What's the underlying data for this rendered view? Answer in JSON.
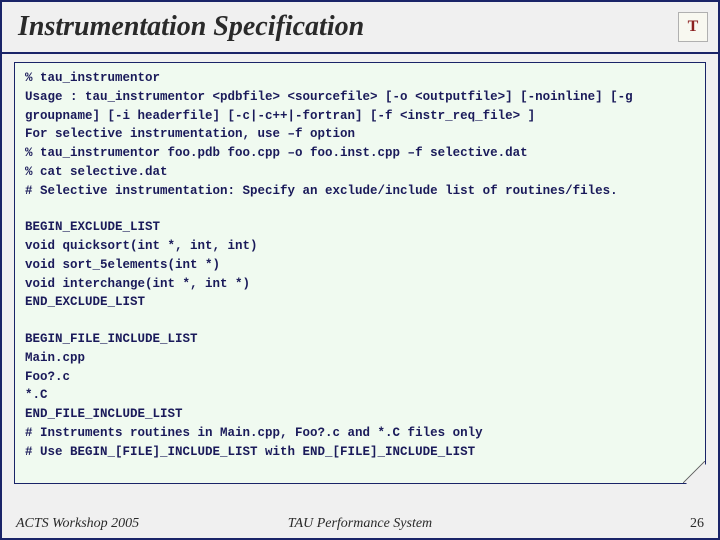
{
  "title": "Instrumentation Specification",
  "logo": "T",
  "code_lines": [
    "% tau_instrumentor",
    "Usage : tau_instrumentor <pdbfile> <sourcefile> [-o <outputfile>] [-noinline] [-g groupname] [-i headerfile] [-c|-c++|-fortran] [-f <instr_req_file> ]",
    "For selective instrumentation, use –f option",
    "% tau_instrumentor foo.pdb foo.cpp –o foo.inst.cpp –f selective.dat",
    "% cat selective.dat",
    "# Selective instrumentation: Specify an exclude/include list of routines/files.",
    "",
    "BEGIN_EXCLUDE_LIST",
    "void quicksort(int *, int, int)",
    "void sort_5elements(int *)",
    "void interchange(int *, int *)",
    "END_EXCLUDE_LIST",
    "",
    "BEGIN_FILE_INCLUDE_LIST",
    "Main.cpp",
    "Foo?.c",
    "*.C",
    "END_FILE_INCLUDE_LIST",
    "# Instruments routines in Main.cpp, Foo?.c and *.C files only",
    "# Use BEGIN_[FILE]_INCLUDE_LIST with END_[FILE]_INCLUDE_LIST"
  ],
  "footer": {
    "left": "ACTS Workshop 2005",
    "center": "TAU Performance System",
    "right": "26"
  }
}
